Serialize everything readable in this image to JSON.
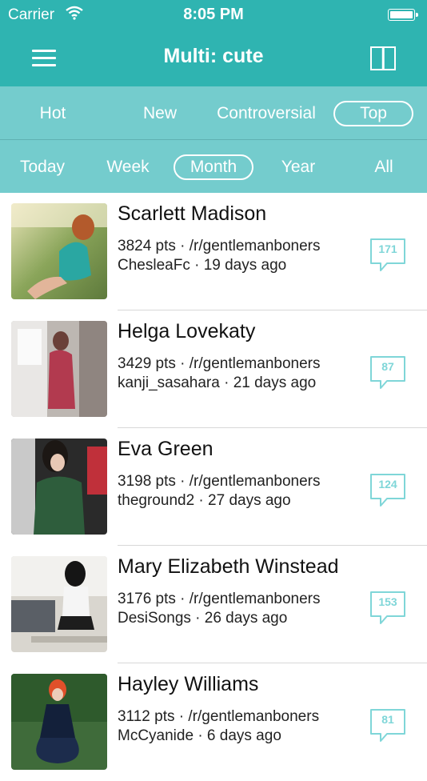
{
  "status_bar": {
    "carrier": "Carrier",
    "time": "8:05 PM"
  },
  "nav": {
    "title": "Multi: cute"
  },
  "sort_tabs": [
    {
      "label": "Hot",
      "active": false
    },
    {
      "label": "New",
      "active": false
    },
    {
      "label": "Controversial",
      "active": false
    },
    {
      "label": "Top",
      "active": true
    }
  ],
  "time_tabs": [
    {
      "label": "Today",
      "active": false
    },
    {
      "label": "Week",
      "active": false
    },
    {
      "label": "Month",
      "active": true
    },
    {
      "label": "Year",
      "active": false
    },
    {
      "label": "All",
      "active": false
    }
  ],
  "posts": [
    {
      "title": "Scarlett Madison",
      "points_sub": "3824 pts · /r/gentlemanboners",
      "author_age": "ChesleaFc · 19 days ago",
      "comments": "171"
    },
    {
      "title": "Helga Lovekaty",
      "points_sub": "3429 pts · /r/gentlemanboners",
      "author_age": "kanji_sasahara · 21 days ago",
      "comments": "87"
    },
    {
      "title": "Eva Green",
      "points_sub": "3198 pts · /r/gentlemanboners",
      "author_age": "theground2 · 27 days ago",
      "comments": "124"
    },
    {
      "title": "Mary Elizabeth Winstead",
      "points_sub": "3176 pts · /r/gentlemanboners",
      "author_age": "DesiSongs · 26 days ago",
      "comments": "153"
    },
    {
      "title": "Hayley Williams",
      "points_sub": "3112 pts · /r/gentlemanboners",
      "author_age": "McCyanide · 6 days ago",
      "comments": "81"
    }
  ],
  "colors": {
    "bar": "#2fb4b1",
    "segment": "#74cccd",
    "comment_accent": "#7fd6d8"
  }
}
